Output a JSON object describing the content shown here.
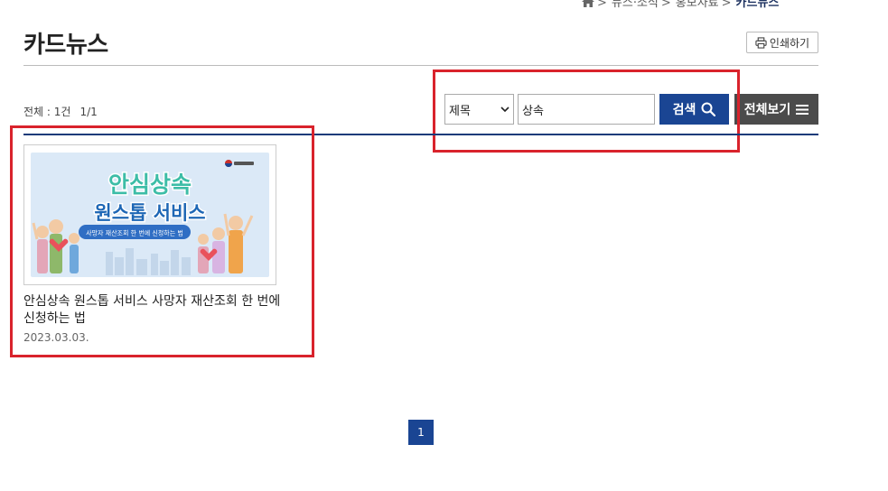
{
  "breadcrumb": {
    "items": [
      "뉴스·소식",
      "홍보자료"
    ],
    "current": "카드뉴스",
    "separator": ">"
  },
  "page": {
    "title": "카드뉴스"
  },
  "toolbar": {
    "print_label": "인쇄하기"
  },
  "list_info": {
    "total": "전체 : 1건",
    "pages": "1/1"
  },
  "search": {
    "field_selected": "제목",
    "query": "상속",
    "search_label": "검색",
    "view_all_label": "전체보기"
  },
  "cards": [
    {
      "thumb_line1": "안심상속",
      "thumb_line2": "원스톱 서비스",
      "thumb_subtitle": "사망자 재산조회 한 번에 신청하는 법",
      "title": "안심상속 원스톱 서비스 사망자 재산조회 한 번에 신청하는 법",
      "date": "2023.03.03."
    }
  ],
  "pagination": {
    "current": "1"
  },
  "colors": {
    "primary": "#1a4593",
    "highlight": "#d9232c",
    "view_all_bg": "#4b4b4b"
  }
}
